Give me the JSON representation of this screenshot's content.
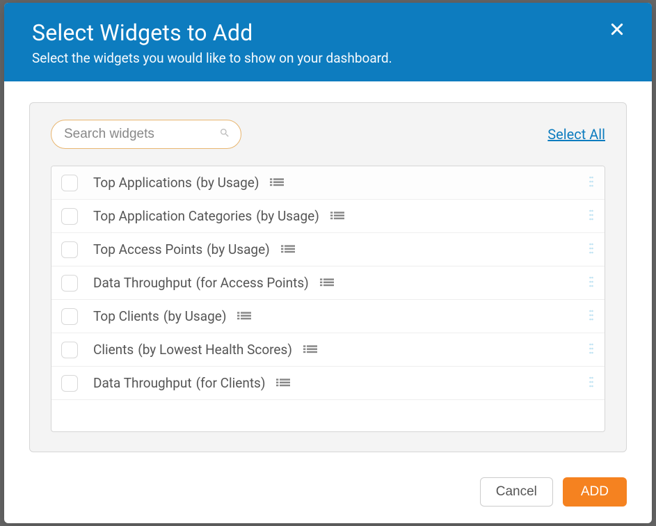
{
  "header": {
    "title": "Select Widgets to Add",
    "subtitle": "Select the widgets you would like to show on your dashboard."
  },
  "search": {
    "placeholder": "Search widgets"
  },
  "select_all_label": "Select All",
  "widgets": [
    {
      "name": "Top Applications",
      "qualifier": "(by Usage)"
    },
    {
      "name": "Top Application Categories",
      "qualifier": "(by Usage)"
    },
    {
      "name": "Top Access Points",
      "qualifier": "(by Usage)"
    },
    {
      "name": "Data Throughput",
      "qualifier": "(for Access Points)"
    },
    {
      "name": "Top Clients",
      "qualifier": "(by Usage)"
    },
    {
      "name": "Clients",
      "qualifier": "(by Lowest Health Scores)"
    },
    {
      "name": "Data Throughput",
      "qualifier": "(for Clients)"
    }
  ],
  "footer": {
    "cancel_label": "Cancel",
    "add_label": "ADD"
  }
}
